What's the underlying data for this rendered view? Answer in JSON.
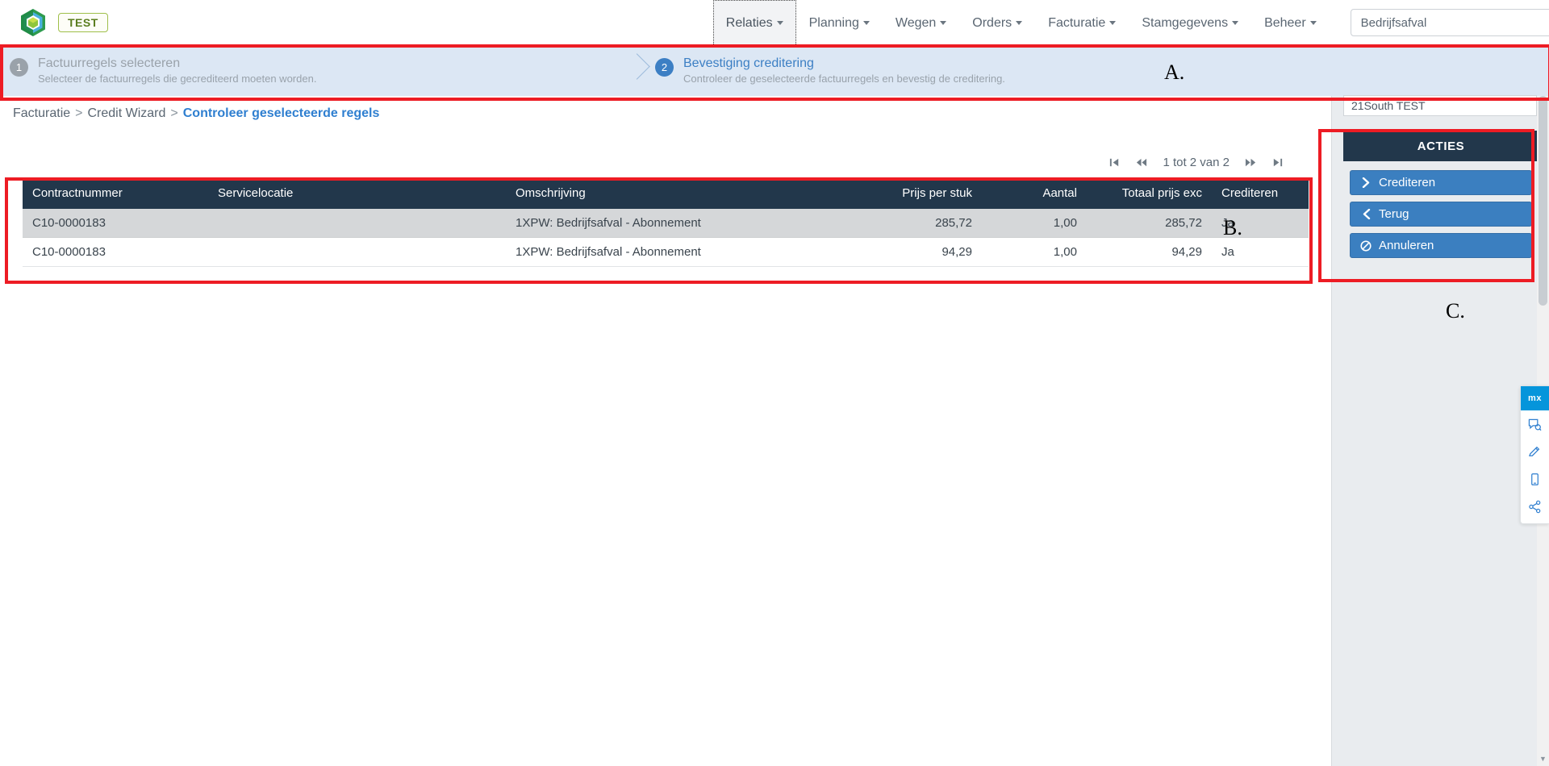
{
  "topnav": {
    "logo_icon": "cube-hexagon-logo",
    "env_badge": "TEST",
    "items": [
      {
        "label": "Relaties",
        "has_caret": true,
        "active": true
      },
      {
        "label": "Planning",
        "has_caret": true,
        "active": false
      },
      {
        "label": "Wegen",
        "has_caret": true,
        "active": false
      },
      {
        "label": "Orders",
        "has_caret": true,
        "active": false
      },
      {
        "label": "Facturatie",
        "has_caret": true,
        "active": false
      },
      {
        "label": "Stamgegevens",
        "has_caret": true,
        "active": false
      },
      {
        "label": "Beheer",
        "has_caret": true,
        "active": false
      }
    ],
    "company_select": {
      "value": "Bedrijfsafval",
      "icon": "chevron-down-icon"
    },
    "logout_icon": "sign-out-icon"
  },
  "wizard": {
    "steps": [
      {
        "number": "1",
        "title": "Factuurregels selecteren",
        "subtitle": "Selecteer de factuurregels die gecrediteerd moeten worden.",
        "state": "done"
      },
      {
        "number": "2",
        "title": "Bevestiging creditering",
        "subtitle": "Controleer de geselecteerde factuurregels en bevestig de creditering.",
        "state": "active"
      }
    ]
  },
  "breadcrumb": {
    "items": [
      "Facturatie",
      "Credit Wizard"
    ],
    "separator": ">",
    "current": "Controleer geselecteerde regels"
  },
  "grid": {
    "pager": {
      "first_icon": "page-first-icon",
      "prev_icon": "page-prev-icon",
      "label": "1 tot 2 van 2",
      "next_icon": "page-next-icon",
      "last_icon": "page-last-icon"
    },
    "columns": [
      {
        "label": "Contractnummer",
        "align": "left"
      },
      {
        "label": "Servicelocatie",
        "align": "left"
      },
      {
        "label": "Omschrijving",
        "align": "left"
      },
      {
        "label": "Prijs per stuk",
        "align": "right"
      },
      {
        "label": "Aantal",
        "align": "right"
      },
      {
        "label": "Totaal prijs exc",
        "align": "right"
      },
      {
        "label": "Crediteren",
        "align": "left"
      }
    ],
    "rows": [
      {
        "contractnummer": "C10-0000183",
        "servicelocatie": "",
        "omschrijving": "1XPW: Bedrijfsafval - Abonnement",
        "prijs_per_stuk": "285,72",
        "aantal": "1,00",
        "totaal_prijs_exc": "285,72",
        "crediteren": "Ja"
      },
      {
        "contractnummer": "C10-0000183",
        "servicelocatie": "",
        "omschrijving": "1XPW: Bedrijfsafval - Abonnement",
        "prijs_per_stuk": "94,29",
        "aantal": "1,00",
        "totaal_prijs_exc": "94,29",
        "crediteren": "Ja"
      }
    ]
  },
  "rightbar": {
    "context_label": "21South TEST",
    "panel_title": "ACTIES",
    "actions": [
      {
        "label": "Crediteren",
        "icon": "chevron-right-icon"
      },
      {
        "label": "Terug",
        "icon": "chevron-left-icon"
      },
      {
        "label": "Annuleren",
        "icon": "ban-icon"
      }
    ]
  },
  "mxbar": {
    "logo": "mx",
    "icons": [
      "feedback-comment-icon",
      "edit-pencil-icon",
      "mobile-preview-icon",
      "share-nodes-icon"
    ]
  },
  "annotations": [
    {
      "letter": "A."
    },
    {
      "letter": "B."
    },
    {
      "letter": "C."
    }
  ],
  "colors": {
    "nav_active_bg": "#f2f3f5",
    "step_active": "#3c7fc4",
    "step_done": "#9aa2aa",
    "steps_bg": "#dce7f4",
    "table_header_bg": "#22374b",
    "action_button_bg": "#3b7fc0",
    "breadcrumb_current": "#2f7fd0",
    "annotation_red": "#ed1c24",
    "badge_green": "#5a7d1e"
  }
}
